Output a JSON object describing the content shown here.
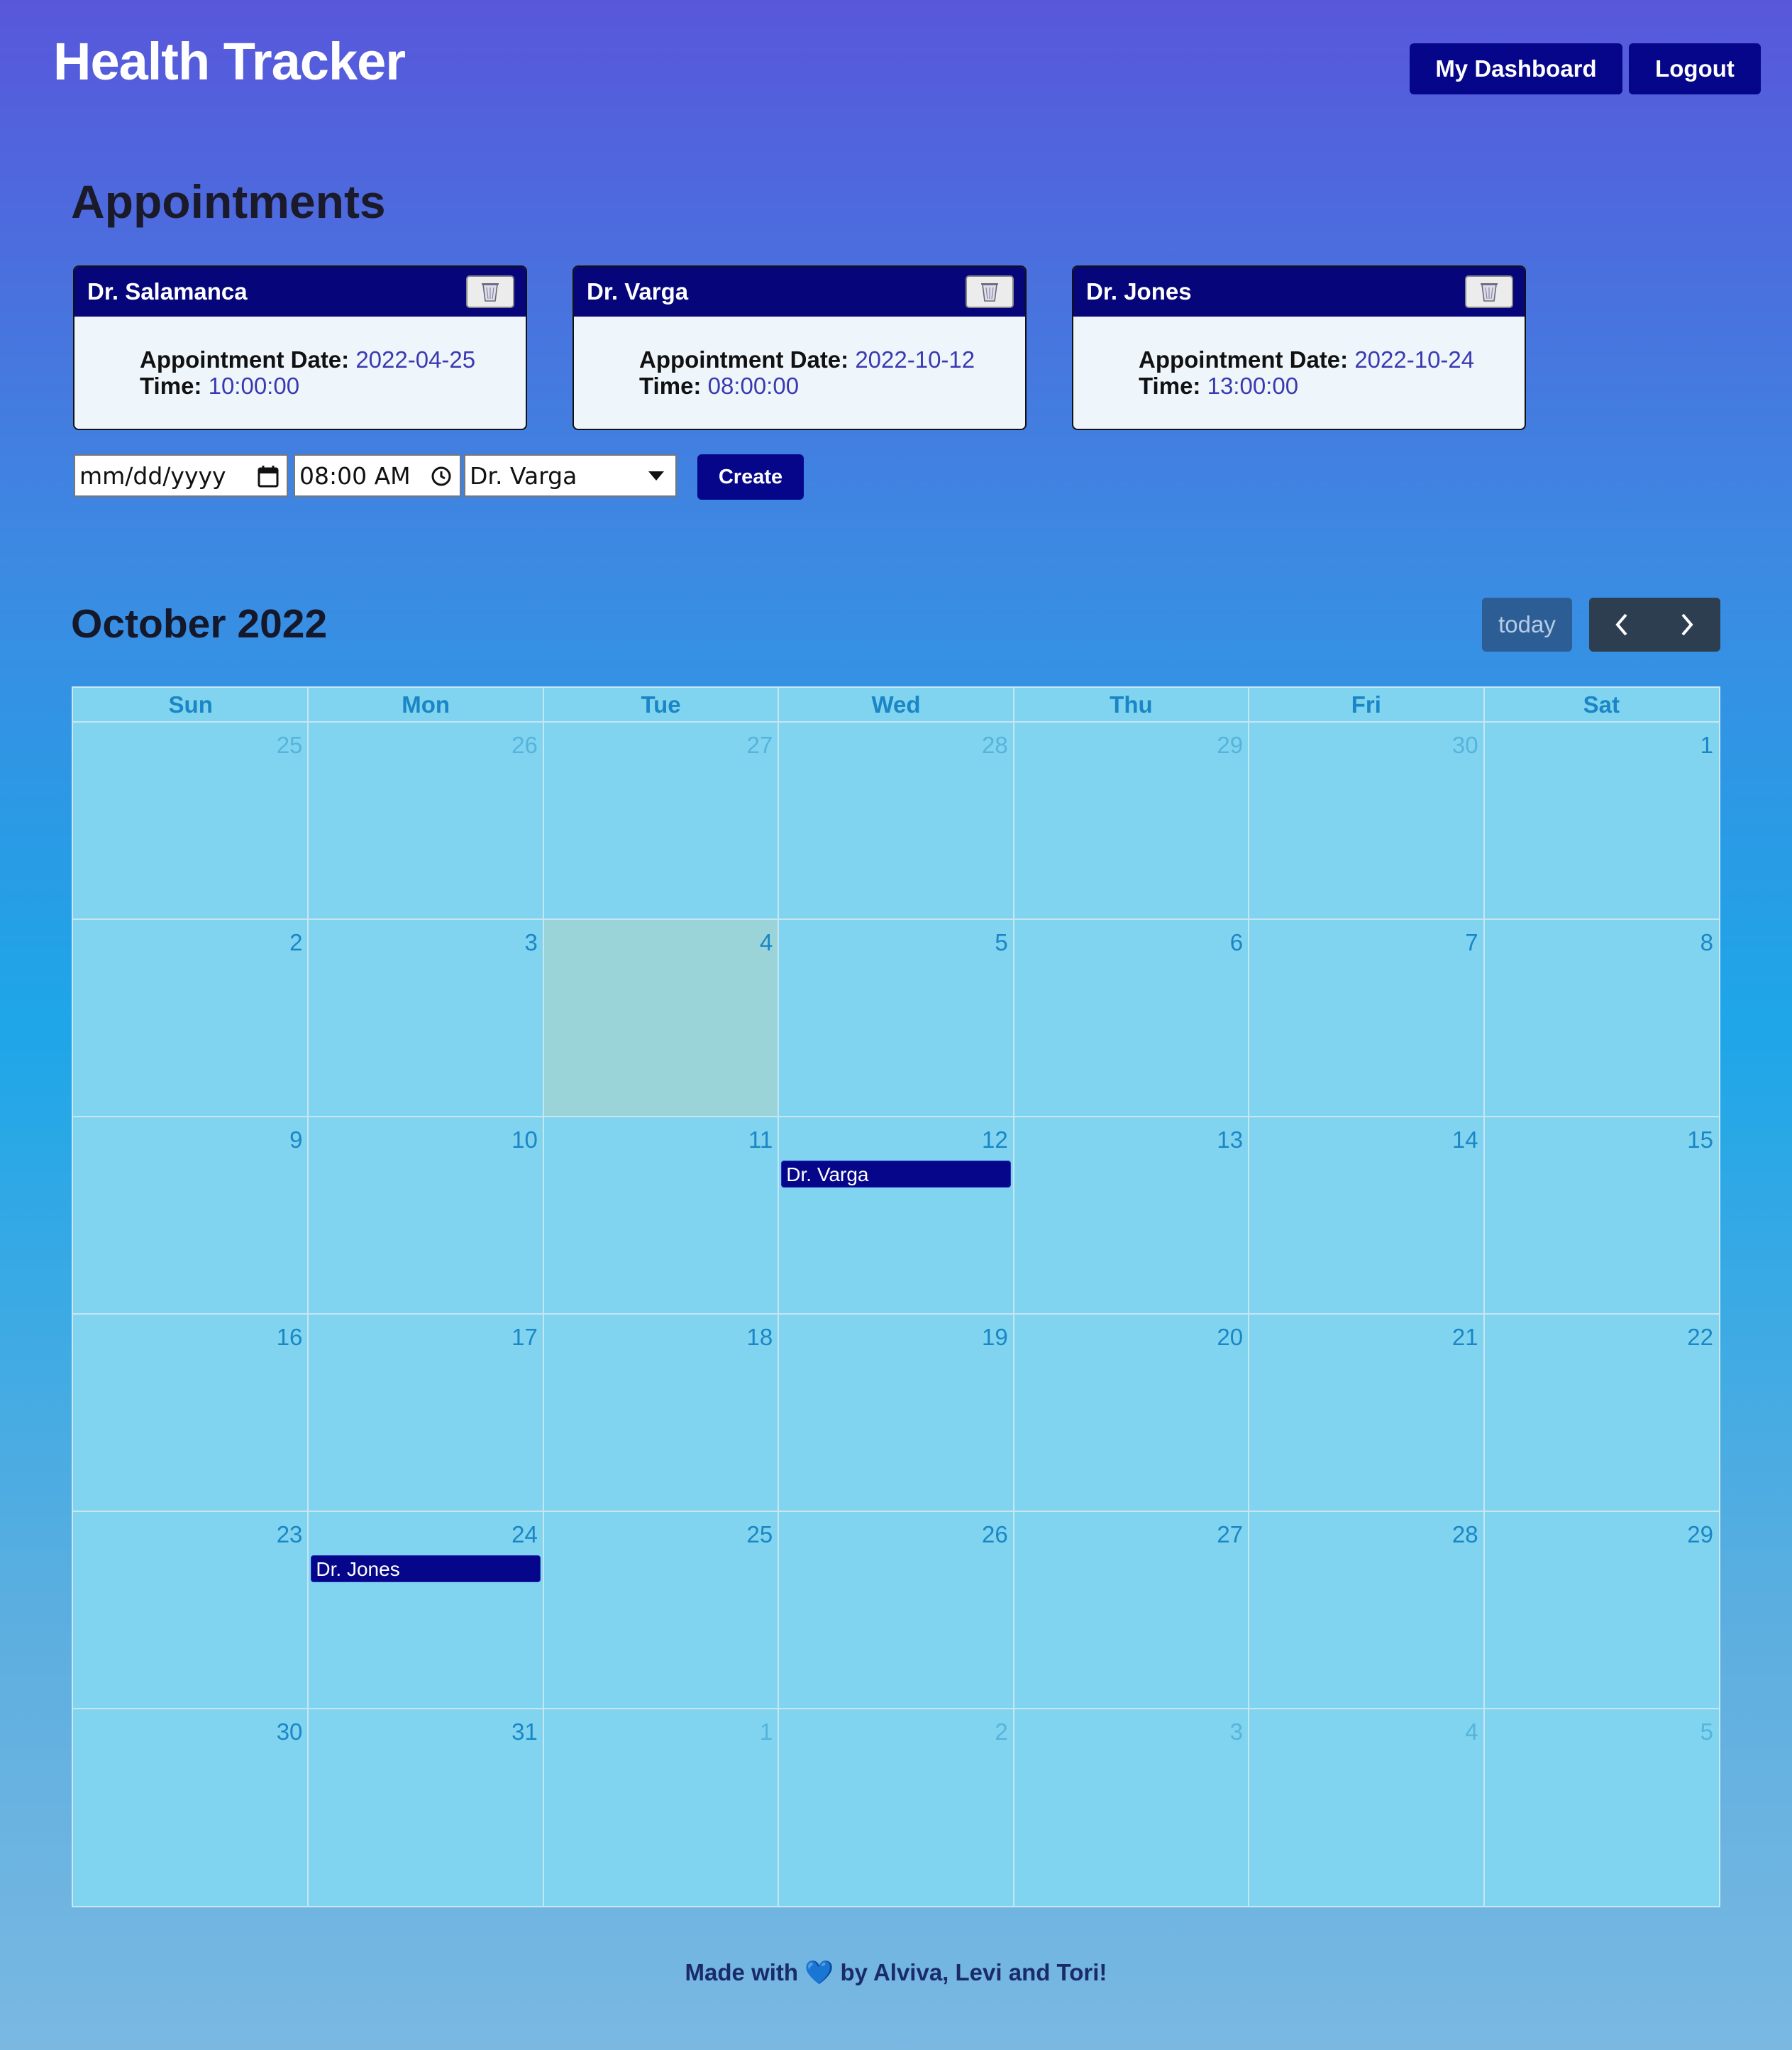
{
  "header": {
    "title": "Health Tracker",
    "dashboard_label": "My Dashboard",
    "logout_label": "Logout"
  },
  "appointments": {
    "title": "Appointments",
    "date_key": "Appointment Date:",
    "time_key": "Time:",
    "cards": [
      {
        "doctor": "Dr. Salamanca",
        "date": "2022-04-25",
        "time": "10:00:00"
      },
      {
        "doctor": "Dr. Varga",
        "date": "2022-10-12",
        "time": "08:00:00"
      },
      {
        "doctor": "Dr. Jones",
        "date": "2022-10-24",
        "time": "13:00:00"
      }
    ]
  },
  "form": {
    "date_placeholder": "mm/dd/yyyy",
    "time_value": "08:00 AM",
    "doctor_selected": "Dr. Varga",
    "create_label": "Create"
  },
  "calendar": {
    "title": "October 2022",
    "today_label": "today",
    "weekdays": [
      "Sun",
      "Mon",
      "Tue",
      "Wed",
      "Thu",
      "Fri",
      "Sat"
    ],
    "weeks": [
      [
        {
          "d": "25",
          "other": true
        },
        {
          "d": "26",
          "other": true
        },
        {
          "d": "27",
          "other": true
        },
        {
          "d": "28",
          "other": true
        },
        {
          "d": "29",
          "other": true
        },
        {
          "d": "30",
          "other": true
        },
        {
          "d": "1"
        }
      ],
      [
        {
          "d": "2"
        },
        {
          "d": "3"
        },
        {
          "d": "4",
          "today": true
        },
        {
          "d": "5"
        },
        {
          "d": "6"
        },
        {
          "d": "7"
        },
        {
          "d": "8"
        }
      ],
      [
        {
          "d": "9"
        },
        {
          "d": "10"
        },
        {
          "d": "11"
        },
        {
          "d": "12",
          "event": "Dr. Varga"
        },
        {
          "d": "13"
        },
        {
          "d": "14"
        },
        {
          "d": "15"
        }
      ],
      [
        {
          "d": "16"
        },
        {
          "d": "17"
        },
        {
          "d": "18"
        },
        {
          "d": "19"
        },
        {
          "d": "20"
        },
        {
          "d": "21"
        },
        {
          "d": "22"
        }
      ],
      [
        {
          "d": "23"
        },
        {
          "d": "24",
          "event": "Dr. Jones"
        },
        {
          "d": "25"
        },
        {
          "d": "26"
        },
        {
          "d": "27"
        },
        {
          "d": "28"
        },
        {
          "d": "29"
        }
      ],
      [
        {
          "d": "30"
        },
        {
          "d": "31"
        },
        {
          "d": "1",
          "other": true
        },
        {
          "d": "2",
          "other": true
        },
        {
          "d": "3",
          "other": true
        },
        {
          "d": "4",
          "other": true
        },
        {
          "d": "5",
          "other": true
        }
      ]
    ]
  },
  "footer": {
    "pre": "Made with",
    "heart": "💙",
    "post": "by Alviva, Levi and Tori!"
  },
  "colors": {
    "accent": "#06068a",
    "today_highlight": "#9bd4d8"
  }
}
